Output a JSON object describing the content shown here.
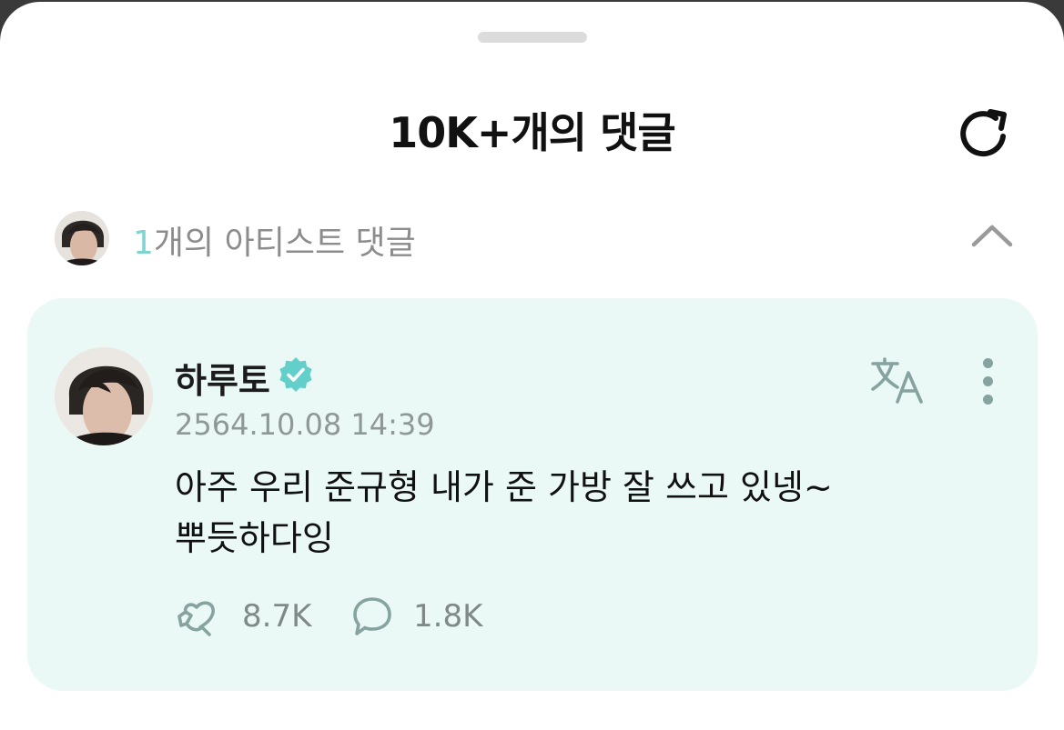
{
  "header": {
    "title": "10K+개의 댓글"
  },
  "artist_comments": {
    "count": "1",
    "label": "개의 아티스트 댓글"
  },
  "comment": {
    "author": "하루토",
    "date": "2564.10.08 14:39",
    "text": "아주 우리 준규형 내가 준 가방 잘 쓰고 있넹~ 뿌듯하다잉",
    "likes": "8.7K",
    "replies": "1.8K"
  },
  "colors": {
    "accent": "#7fd3d0",
    "card_background": "#eaf9f6",
    "muted_icon": "#86a3a0"
  },
  "icons": {
    "refresh": "refresh-icon",
    "collapse": "chevron-up-icon",
    "verified": "verified-badge-icon",
    "translate": "translate-icon",
    "more": "more-vertical-icon",
    "like": "heart-icon",
    "reply": "comment-bubble-icon"
  }
}
